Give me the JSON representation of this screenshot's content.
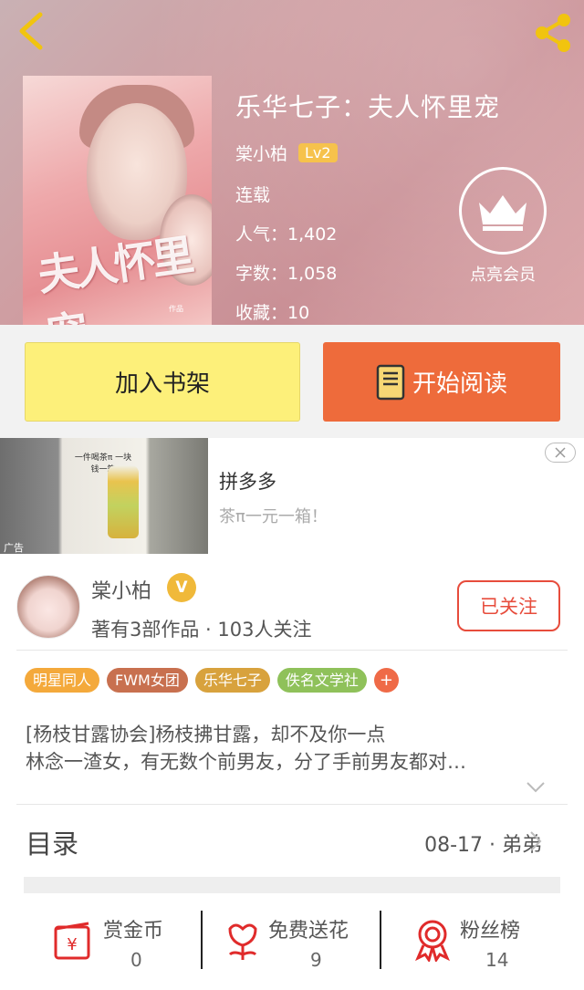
{
  "book": {
    "title": "乐华七子：夫人怀里宠",
    "author": "棠小柏",
    "level": "Lv2",
    "status": "连载",
    "popularity": "人气：1,402",
    "word_count": "字数：1,058",
    "favorites": "收藏：10",
    "cover_title_art": "夫人怀里宠",
    "cover_credits": "作品"
  },
  "vip": {
    "label": "点亮会员",
    "icon": "crown-icon"
  },
  "actions": {
    "add_shelf": "加入书架",
    "start_reading": "开始阅读"
  },
  "ad": {
    "title": "拼多多",
    "subtitle": "茶π一元一箱！",
    "tag": "广告",
    "image_caption": "一件喝茶π 一块钱一箱"
  },
  "author_card": {
    "name": "棠小柏",
    "verified_mark": "V",
    "meta": "著有3部作品 · 103人关注",
    "follow_label": "已关注"
  },
  "tags": [
    {
      "label": "明星同人",
      "color": "#f4a93b"
    },
    {
      "label": "FWM女团",
      "color": "#c8704f"
    },
    {
      "label": "乐华七子",
      "color": "#d8a23d"
    },
    {
      "label": "佚名文学社",
      "color": "#8fc15a"
    }
  ],
  "tag_more": "+",
  "description": {
    "line1": "[杨枝甘露协会]杨枝拂甘露，却不及你一点",
    "line2": "林念一渣女，有无数个前男友，分了手前男友都对…"
  },
  "toc": {
    "label": "目录",
    "latest": "08-17 · 弟弟"
  },
  "stats": [
    {
      "label": "赏金币",
      "value": "0",
      "icon": "reward-coin-icon"
    },
    {
      "label": "免费送花",
      "value": "9",
      "icon": "flower-icon"
    },
    {
      "label": "粉丝榜",
      "value": "14",
      "icon": "medal-icon"
    }
  ],
  "colors": {
    "accent_orange": "#ee6b3b",
    "shelf_yellow": "#fdf07a",
    "follow_red": "#e74c3c",
    "level_badge": "#f6c24c"
  }
}
